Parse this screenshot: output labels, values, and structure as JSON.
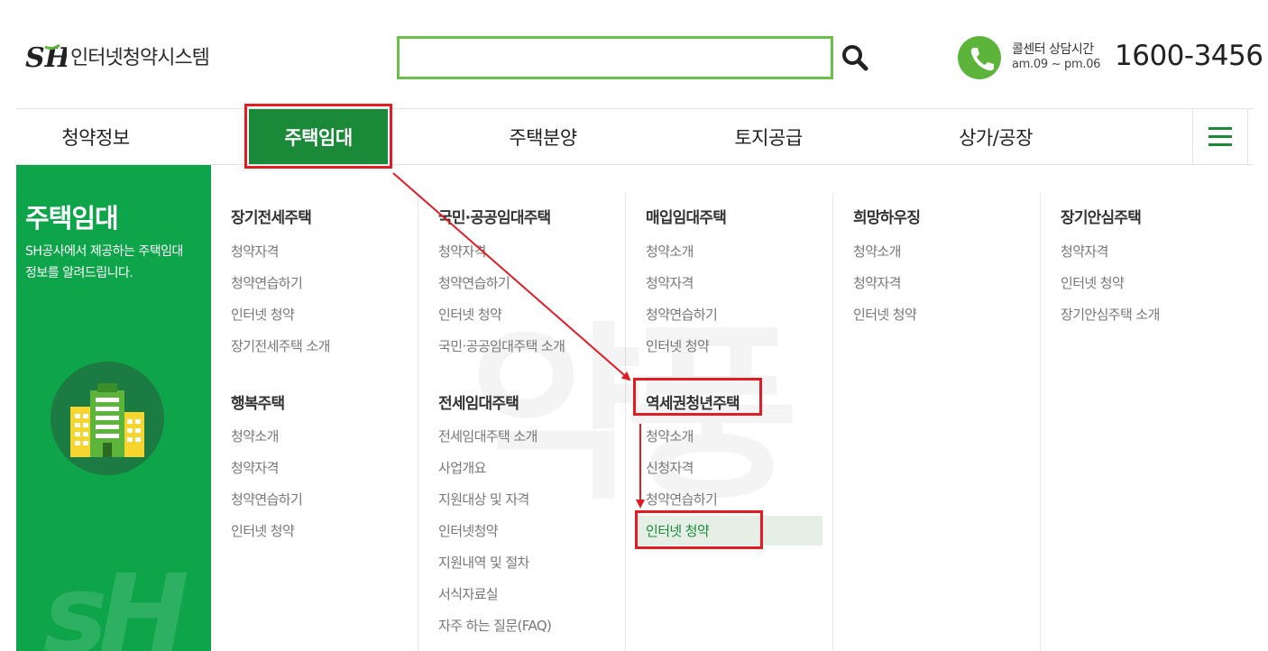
{
  "header": {
    "logo_letters": "SH",
    "logo_text": "인터넷청약시스템",
    "search": {
      "value": "",
      "placeholder": ""
    },
    "search_icon": "search-icon",
    "call_center": {
      "icon": "phone-icon",
      "label": "콜센터 상담시간",
      "hours": "am.09 ~ pm.06",
      "phone": "1600-3456"
    }
  },
  "gnb": {
    "items": [
      "청약정보",
      "주택임대",
      "주택분양",
      "토지공급",
      "상가/공장"
    ],
    "active": "주택임대",
    "menu_icon": "hamburger-icon"
  },
  "mega": {
    "title": "주택임대",
    "desc": "SH공사에서 제공하는 주택임대 정보를 알려드립니다.",
    "illustration": "building-icon",
    "columns": [
      {
        "groups": [
          {
            "title": "장기전세주택",
            "items": [
              "청약자격",
              "청약연습하기",
              "인터넷 청약",
              "장기전세주택 소개"
            ]
          },
          {
            "title": "행복주택",
            "items": [
              "청약소개",
              "청약자격",
              "청약연습하기",
              "인터넷 청약"
            ]
          }
        ]
      },
      {
        "groups": [
          {
            "title": "국민·공공임대주택",
            "items": [
              "청약자격",
              "청약연습하기",
              "인터넷 청약",
              "국민·공공임대주택 소개"
            ]
          },
          {
            "title": "전세임대주택",
            "items": [
              "전세임대주택 소개",
              "사업개요",
              "지원대상 및 자격",
              "인터넷청약",
              "지원내역 및 절차",
              "서식자료실",
              "자주 하는 질문(FAQ)"
            ]
          }
        ]
      },
      {
        "groups": [
          {
            "title": "매입임대주택",
            "items": [
              "청약소개",
              "청약자격",
              "청약연습하기",
              "인터넷 청약"
            ]
          },
          {
            "title": "역세권청년주택",
            "items": [
              "청약소개",
              "신청자격",
              "청약연습하기",
              "인터넷 청약"
            ]
          }
        ]
      },
      {
        "groups": [
          {
            "title": "희망하우징",
            "items": [
              "청약소개",
              "청약자격",
              "인터넷 청약"
            ]
          }
        ]
      },
      {
        "groups": [
          {
            "title": "장기안심주택",
            "items": [
              "청약자격",
              "인터넷 청약",
              "장기안심주택 소개"
            ]
          }
        ]
      }
    ],
    "highlighted_item": "인터넷 청약"
  },
  "colors": {
    "brand_green": "#1a8a38",
    "side_green": "#0ea54a",
    "search_border": "#6cbf4a",
    "annotation_red": "#e31b23"
  }
}
